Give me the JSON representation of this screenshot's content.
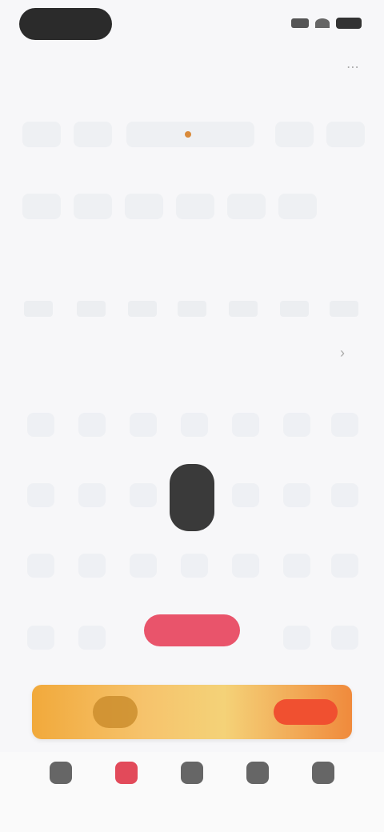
{
  "status_bar": {
    "time": "",
    "icons": [
      "signal-icon",
      "wifi-icon",
      "battery-icon"
    ]
  },
  "header": {
    "title": "",
    "action_icon": "share-icon"
  },
  "categories_row1": [
    "",
    "",
    "",
    "",
    ""
  ],
  "categories_row2": [
    "",
    "",
    "",
    "",
    "",
    ""
  ],
  "section": {
    "title": "",
    "subtabs": [
      "",
      "",
      "",
      "",
      "",
      "",
      ""
    ]
  },
  "grid": {
    "rows": [
      [
        "",
        "",
        "",
        "",
        "",
        "",
        ""
      ],
      [
        "",
        "",
        "",
        "",
        "",
        "",
        ""
      ],
      [
        "",
        "",
        "",
        "",
        "",
        "",
        ""
      ],
      [
        "",
        "",
        "",
        "",
        "",
        "",
        ""
      ]
    ],
    "selected_label": ""
  },
  "promo": {
    "text": "",
    "cta": ""
  },
  "tabbar": {
    "items": [
      {
        "label": "",
        "icon": "home-icon"
      },
      {
        "label": "",
        "icon": "gift-icon"
      },
      {
        "label": "",
        "icon": "cart-icon"
      },
      {
        "label": "",
        "icon": "message-icon"
      },
      {
        "label": "",
        "icon": "profile-icon"
      }
    ],
    "active_index": 1
  },
  "colors": {
    "accent": "#e9546b",
    "section_title": "#f0524f",
    "promo_start": "#f1a93b",
    "promo_end": "#f08a3c"
  }
}
